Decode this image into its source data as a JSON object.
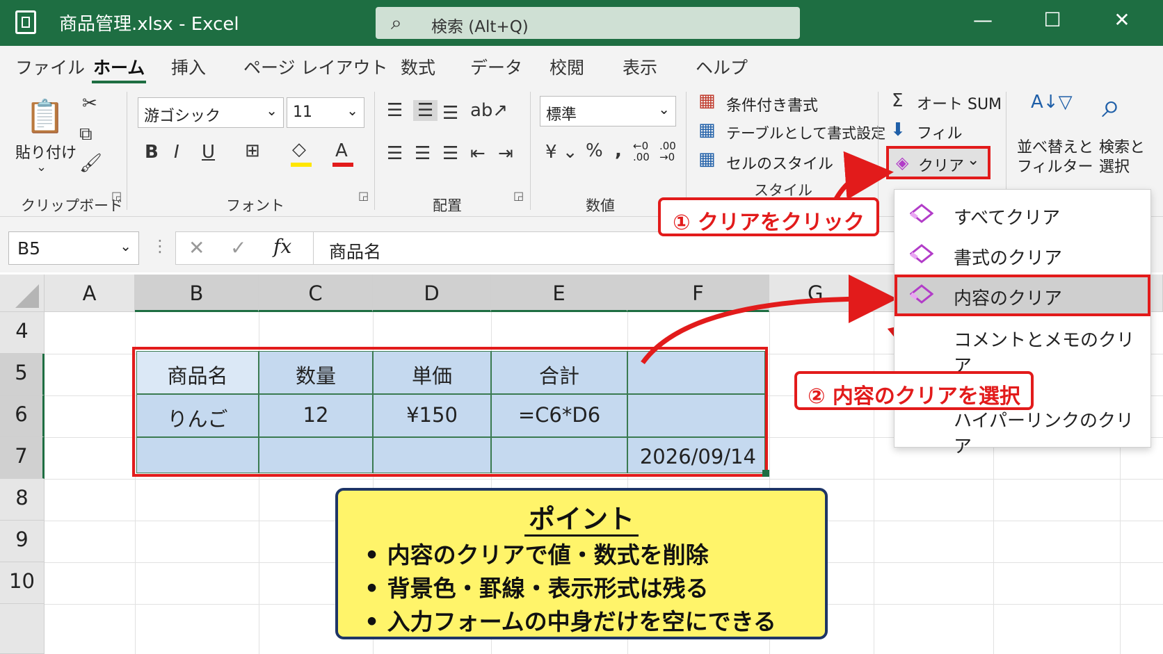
{
  "window": {
    "title": "商品管理.xlsx  -  Excel",
    "search_placeholder": "検索 (Alt+Q)",
    "minimize": "—",
    "maximize": "☐",
    "close": "✕"
  },
  "tabs": [
    "ファイル",
    "ホーム",
    "挿入",
    "ページ レイアウト",
    "数式",
    "データ",
    "校閲",
    "表示",
    "ヘルプ"
  ],
  "active_tab": "ホーム",
  "ribbon": {
    "clipboard": {
      "paste": "貼り付け",
      "label": "クリップボード"
    },
    "font": {
      "name": "游ゴシック",
      "size": "11",
      "label": "フォント"
    },
    "alignment": {
      "label": "配置"
    },
    "number": {
      "format": "標準",
      "label": "数値"
    },
    "styles": {
      "conditional": "条件付き書式",
      "as_table": "テーブルとして書式設定",
      "cell_styles": "セルのスタイル",
      "label": "スタイル"
    },
    "editing": {
      "autosum": "オート SUM",
      "fill": "フィル",
      "clear": "クリア",
      "sort": "並べ替えと",
      "sort2": "フィルター",
      "find": "検索と",
      "find2": "選択"
    }
  },
  "formula_bar": {
    "name_box": "B5",
    "formula": "商品名"
  },
  "columns": [
    "A",
    "B",
    "C",
    "D",
    "E",
    "F",
    "G"
  ],
  "rows": [
    "4",
    "5",
    "6",
    "7",
    "8",
    "9",
    "10"
  ],
  "table": {
    "header": [
      "商品名",
      "数量",
      "単価",
      "合計",
      ""
    ],
    "row6": [
      "りんご",
      "12",
      "¥150",
      "=C6*D6",
      ""
    ],
    "row7": [
      "",
      "",
      "",
      "",
      "2026/09/14"
    ]
  },
  "clear_menu": [
    "すべてクリア",
    "書式のクリア",
    "内容のクリア",
    "コメントとメモのクリア",
    "ハイパーリンクのクリア"
  ],
  "callouts": {
    "step1": "① クリアをクリック",
    "step2": "② 内容のクリアを選択"
  },
  "point": {
    "title": "ポイント",
    "bullets": [
      "• 内容のクリアで値・数式を削除",
      "• 背景色・罫線・表示形式は残る",
      "• 入力フォームの中身だけを空にできる"
    ]
  },
  "colors": {
    "excel_green": "#1e6e42",
    "highlight_red": "#e21b1b",
    "cell_blue": "#c5d9ef",
    "point_yellow": "#fff46a",
    "eraser_purple": "#b23cc8"
  }
}
